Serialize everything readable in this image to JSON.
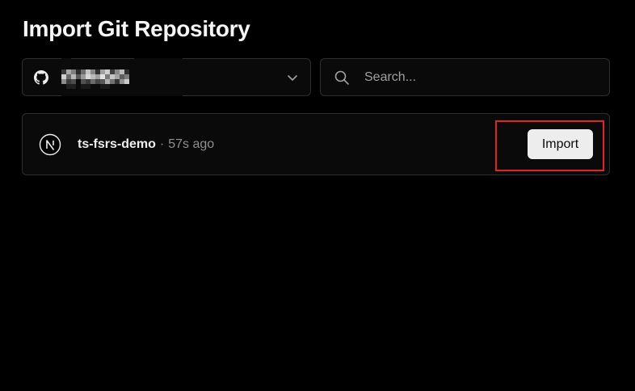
{
  "page": {
    "title": "Import Git Repository"
  },
  "account_selector": {
    "provider_icon": "github-icon",
    "account_name_redacted": true,
    "chevron_icon": "chevron-down-icon"
  },
  "search": {
    "placeholder": "Search...",
    "value": "",
    "icon": "search-icon"
  },
  "repositories": [
    {
      "framework_icon": "nextjs-icon",
      "name": "ts-fsrs-demo",
      "separator": "·",
      "updated": "57s ago",
      "action_label": "Import"
    }
  ],
  "colors": {
    "background": "#000000",
    "surface": "#0a0a0a",
    "border": "#2e2e2e",
    "text_primary": "#ededed",
    "text_muted": "#8f8f8f",
    "button_bg": "#ededed",
    "highlight": "#e0242a"
  }
}
